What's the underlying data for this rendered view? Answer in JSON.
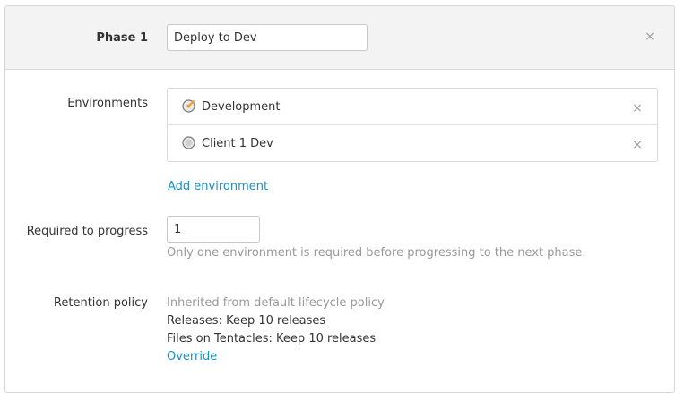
{
  "phase": {
    "label": "Phase 1",
    "name_value": "Deploy to Dev"
  },
  "environments": {
    "label": "Environments",
    "items": [
      {
        "name": "Development",
        "icon": "environment-active-icon"
      },
      {
        "name": "Client 1 Dev",
        "icon": "environment-icon"
      }
    ],
    "add_label": "Add environment"
  },
  "required": {
    "label": "Required to progress",
    "value": "1",
    "help": "Only one environment is required before progressing to the next phase."
  },
  "retention": {
    "label": "Retention policy",
    "inherited": "Inherited from default lifecycle policy",
    "releases": "Releases: Keep 10 releases",
    "files": "Files on Tentacles: Keep 10 releases",
    "override_label": "Override"
  },
  "icons": {
    "close": "×"
  },
  "colors": {
    "link": "#1a8fc9",
    "muted_text": "#999999",
    "header_bg": "#f3f3f3",
    "active_env_accent": "#f0a030"
  }
}
